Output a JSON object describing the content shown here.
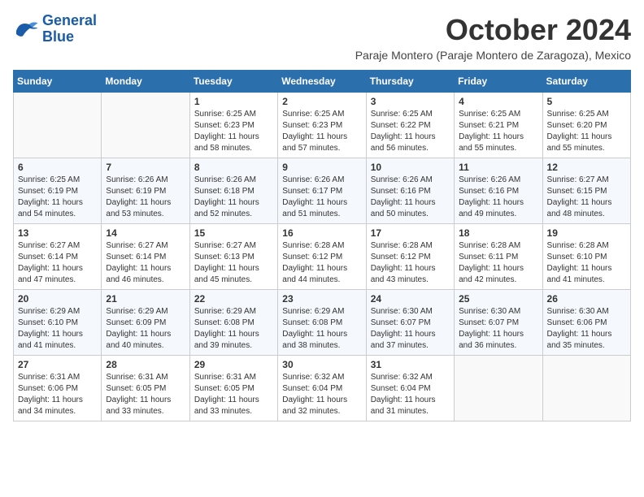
{
  "logo": {
    "line1": "General",
    "line2": "Blue"
  },
  "title": "October 2024",
  "location": "Paraje Montero (Paraje Montero de Zaragoza), Mexico",
  "days_header": [
    "Sunday",
    "Monday",
    "Tuesday",
    "Wednesday",
    "Thursday",
    "Friday",
    "Saturday"
  ],
  "weeks": [
    [
      {
        "day": "",
        "info": ""
      },
      {
        "day": "",
        "info": ""
      },
      {
        "day": "1",
        "info": "Sunrise: 6:25 AM\nSunset: 6:23 PM\nDaylight: 11 hours and 58 minutes."
      },
      {
        "day": "2",
        "info": "Sunrise: 6:25 AM\nSunset: 6:23 PM\nDaylight: 11 hours and 57 minutes."
      },
      {
        "day": "3",
        "info": "Sunrise: 6:25 AM\nSunset: 6:22 PM\nDaylight: 11 hours and 56 minutes."
      },
      {
        "day": "4",
        "info": "Sunrise: 6:25 AM\nSunset: 6:21 PM\nDaylight: 11 hours and 55 minutes."
      },
      {
        "day": "5",
        "info": "Sunrise: 6:25 AM\nSunset: 6:20 PM\nDaylight: 11 hours and 55 minutes."
      }
    ],
    [
      {
        "day": "6",
        "info": "Sunrise: 6:25 AM\nSunset: 6:19 PM\nDaylight: 11 hours and 54 minutes."
      },
      {
        "day": "7",
        "info": "Sunrise: 6:26 AM\nSunset: 6:19 PM\nDaylight: 11 hours and 53 minutes."
      },
      {
        "day": "8",
        "info": "Sunrise: 6:26 AM\nSunset: 6:18 PM\nDaylight: 11 hours and 52 minutes."
      },
      {
        "day": "9",
        "info": "Sunrise: 6:26 AM\nSunset: 6:17 PM\nDaylight: 11 hours and 51 minutes."
      },
      {
        "day": "10",
        "info": "Sunrise: 6:26 AM\nSunset: 6:16 PM\nDaylight: 11 hours and 50 minutes."
      },
      {
        "day": "11",
        "info": "Sunrise: 6:26 AM\nSunset: 6:16 PM\nDaylight: 11 hours and 49 minutes."
      },
      {
        "day": "12",
        "info": "Sunrise: 6:27 AM\nSunset: 6:15 PM\nDaylight: 11 hours and 48 minutes."
      }
    ],
    [
      {
        "day": "13",
        "info": "Sunrise: 6:27 AM\nSunset: 6:14 PM\nDaylight: 11 hours and 47 minutes."
      },
      {
        "day": "14",
        "info": "Sunrise: 6:27 AM\nSunset: 6:14 PM\nDaylight: 11 hours and 46 minutes."
      },
      {
        "day": "15",
        "info": "Sunrise: 6:27 AM\nSunset: 6:13 PM\nDaylight: 11 hours and 45 minutes."
      },
      {
        "day": "16",
        "info": "Sunrise: 6:28 AM\nSunset: 6:12 PM\nDaylight: 11 hours and 44 minutes."
      },
      {
        "day": "17",
        "info": "Sunrise: 6:28 AM\nSunset: 6:12 PM\nDaylight: 11 hours and 43 minutes."
      },
      {
        "day": "18",
        "info": "Sunrise: 6:28 AM\nSunset: 6:11 PM\nDaylight: 11 hours and 42 minutes."
      },
      {
        "day": "19",
        "info": "Sunrise: 6:28 AM\nSunset: 6:10 PM\nDaylight: 11 hours and 41 minutes."
      }
    ],
    [
      {
        "day": "20",
        "info": "Sunrise: 6:29 AM\nSunset: 6:10 PM\nDaylight: 11 hours and 41 minutes."
      },
      {
        "day": "21",
        "info": "Sunrise: 6:29 AM\nSunset: 6:09 PM\nDaylight: 11 hours and 40 minutes."
      },
      {
        "day": "22",
        "info": "Sunrise: 6:29 AM\nSunset: 6:08 PM\nDaylight: 11 hours and 39 minutes."
      },
      {
        "day": "23",
        "info": "Sunrise: 6:29 AM\nSunset: 6:08 PM\nDaylight: 11 hours and 38 minutes."
      },
      {
        "day": "24",
        "info": "Sunrise: 6:30 AM\nSunset: 6:07 PM\nDaylight: 11 hours and 37 minutes."
      },
      {
        "day": "25",
        "info": "Sunrise: 6:30 AM\nSunset: 6:07 PM\nDaylight: 11 hours and 36 minutes."
      },
      {
        "day": "26",
        "info": "Sunrise: 6:30 AM\nSunset: 6:06 PM\nDaylight: 11 hours and 35 minutes."
      }
    ],
    [
      {
        "day": "27",
        "info": "Sunrise: 6:31 AM\nSunset: 6:06 PM\nDaylight: 11 hours and 34 minutes."
      },
      {
        "day": "28",
        "info": "Sunrise: 6:31 AM\nSunset: 6:05 PM\nDaylight: 11 hours and 33 minutes."
      },
      {
        "day": "29",
        "info": "Sunrise: 6:31 AM\nSunset: 6:05 PM\nDaylight: 11 hours and 33 minutes."
      },
      {
        "day": "30",
        "info": "Sunrise: 6:32 AM\nSunset: 6:04 PM\nDaylight: 11 hours and 32 minutes."
      },
      {
        "day": "31",
        "info": "Sunrise: 6:32 AM\nSunset: 6:04 PM\nDaylight: 11 hours and 31 minutes."
      },
      {
        "day": "",
        "info": ""
      },
      {
        "day": "",
        "info": ""
      }
    ]
  ]
}
